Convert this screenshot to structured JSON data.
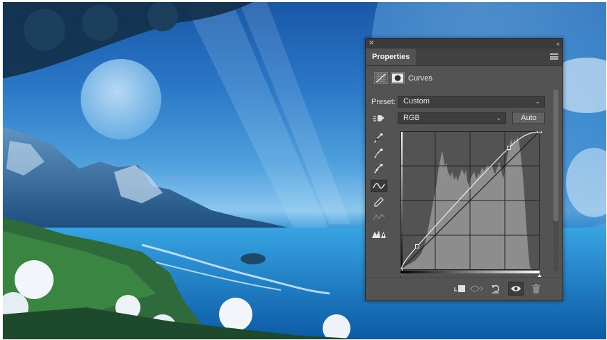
{
  "panel": {
    "tab_label": "Properties",
    "adjustment_title": "Curves",
    "preset_label": "Preset:",
    "preset_value": "Custom",
    "channel_value": "RGB",
    "auto_label": "Auto"
  },
  "icons": {
    "close": "close-icon",
    "collapse": "collapse-icon",
    "panel_menu": "hamburger-icon",
    "adjustment": "curves-adjustment-icon",
    "mask": "mask-icon",
    "on_image": "targeted-adjustment-icon",
    "tools": [
      "black-point-eyedropper-icon",
      "gray-point-eyedropper-icon",
      "white-point-eyedropper-icon",
      "curve-point-icon",
      "pencil-icon",
      "smooth-icon",
      "clipping-warning-icon"
    ],
    "footer": [
      "clip-to-layer-icon",
      "view-previous-state-icon",
      "reset-icon",
      "visibility-eye-icon",
      "trash-icon"
    ]
  },
  "colors": {
    "panel_bg": "#535353",
    "histogram": "#8d8d8d",
    "grid": "#232323",
    "curve": "#f0f0f0"
  },
  "curve_points": [
    [
      0,
      0
    ],
    [
      0.12,
      0.17
    ],
    [
      0.78,
      0.88
    ],
    [
      1,
      1
    ]
  ]
}
